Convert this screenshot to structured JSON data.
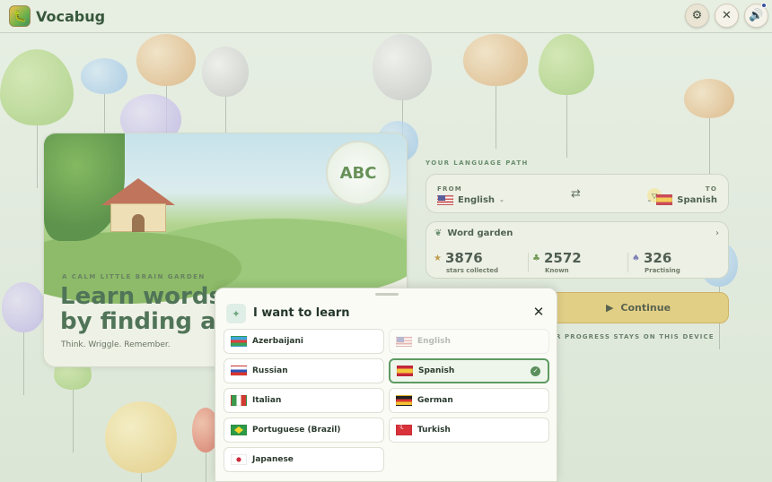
{
  "app": {
    "name": "Vocabug"
  },
  "header": {
    "buttons": [
      "settings",
      "focus",
      "sound"
    ]
  },
  "hero": {
    "kicker": "A CALM LITTLE BRAIN GARDEN",
    "title": "Learn words\nby finding a w",
    "subtitle": "Think. Wriggle. Remember.",
    "mascot_letters": "ABC"
  },
  "language_path": {
    "label": "YOUR LANGUAGE PATH",
    "from_label": "FROM",
    "from_value": "English",
    "to_label": "TO",
    "to_value": "Spanish"
  },
  "word_garden": {
    "title": "Word garden",
    "stats": [
      {
        "value": "3876",
        "label": "stars collected"
      },
      {
        "value": "2572",
        "label": "Known"
      },
      {
        "value": "326",
        "label": "Practising"
      }
    ]
  },
  "continue_label": "Continue",
  "progress_note": "R PROGRESS STAYS ON THIS DEVICE",
  "sheet": {
    "title": "I want to learn",
    "left_options": [
      "Azerbaijani",
      "Russian",
      "Italian",
      "Portuguese (Brazil)",
      "Japanese"
    ],
    "right_options": [
      "English",
      "Spanish",
      "German",
      "Turkish"
    ],
    "selected": "Spanish",
    "disabled": "English"
  },
  "colors": {
    "accent_green": "#5e9a62",
    "continue_bg": "#e1c872",
    "brand_text": "#36573b"
  }
}
